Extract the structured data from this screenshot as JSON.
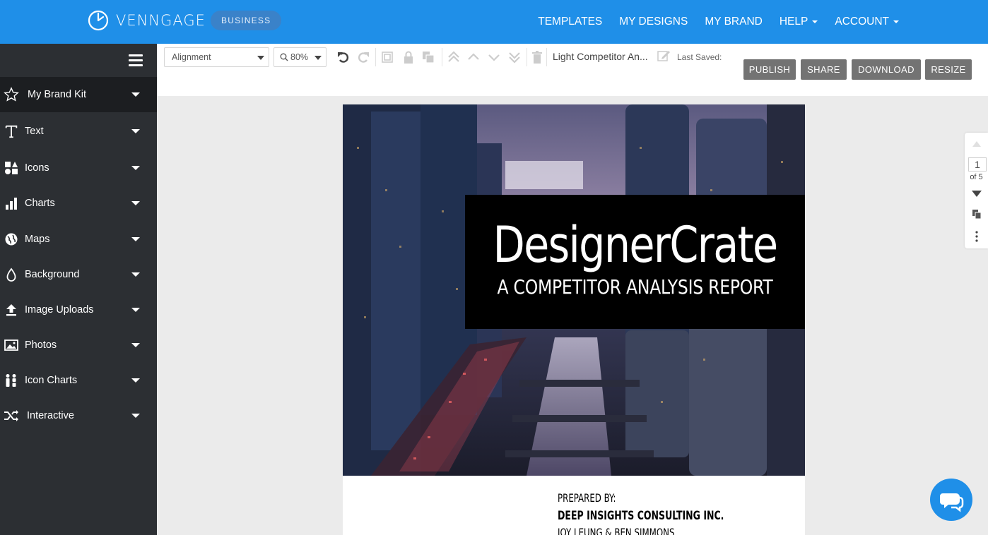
{
  "app": {
    "brand": "VENNGAGE",
    "plan_badge": "BUSINESS",
    "colors": {
      "topbar": "#1f8fe8",
      "sidebar": "#2c2f33",
      "button": "#737373",
      "chat": "#1f8fe8"
    }
  },
  "topnav": {
    "items": [
      {
        "label": "TEMPLATES",
        "has_caret": false
      },
      {
        "label": "MY DESIGNS",
        "has_caret": false
      },
      {
        "label": "MY BRAND",
        "has_caret": false
      },
      {
        "label": "HELP",
        "has_caret": true
      },
      {
        "label": "ACCOUNT",
        "has_caret": true
      }
    ]
  },
  "sidebar": {
    "menu_icon": "hamburger-icon",
    "items": [
      {
        "label": "My Brand Kit",
        "icon": "star-icon"
      },
      {
        "label": "Text",
        "icon": "text-icon"
      },
      {
        "label": "Icons",
        "icon": "shapes-icon"
      },
      {
        "label": "Charts",
        "icon": "bar-chart-icon"
      },
      {
        "label": "Maps",
        "icon": "globe-icon"
      },
      {
        "label": "Background",
        "icon": "droplet-icon"
      },
      {
        "label": "Image Uploads",
        "icon": "upload-icon"
      },
      {
        "label": "Photos",
        "icon": "image-icon"
      },
      {
        "label": "Icon Charts",
        "icon": "people-icon"
      },
      {
        "label": "Interactive",
        "icon": "shuffle-icon"
      }
    ]
  },
  "toolbar": {
    "alignment_select": "Alignment",
    "zoom_select": "80%",
    "document_name": "Light Competitor An...",
    "last_saved_label": "Last Saved:",
    "buttons": {
      "publish": "PUBLISH",
      "share": "SHARE",
      "download": "DOWNLOAD",
      "resize": "RESIZE"
    }
  },
  "canvas": {
    "title": "DesignerCrate",
    "subtitle": "A COMPETITOR ANALYSIS REPORT",
    "prepared_by_label": "PREPARED BY:",
    "company": "DEEP INSIGHTS CONSULTING INC.",
    "authors": "JOY LEUNG & BEN SIMMONS"
  },
  "pagenav": {
    "current_page": "1",
    "of_label": "of 5"
  }
}
